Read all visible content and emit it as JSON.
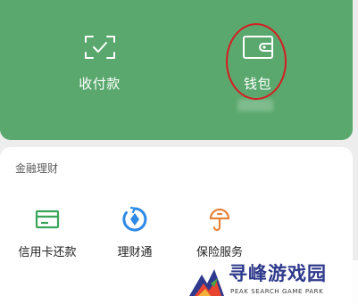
{
  "top_card": {
    "background": "#5aa86d",
    "actions": [
      {
        "label": "收付款",
        "icon": "scan-pay-icon"
      },
      {
        "label": "钱包",
        "icon": "wallet-icon"
      }
    ]
  },
  "annotation": {
    "circle_color": "#d51d22"
  },
  "finance": {
    "title": "金融理财",
    "items": [
      {
        "label": "信用卡还款",
        "icon": "credit-card-icon",
        "color": "#3aa55a"
      },
      {
        "label": "理财通",
        "icon": "licaitong-icon",
        "color": "#2d8ae6"
      },
      {
        "label": "保险服务",
        "icon": "insurance-icon",
        "color": "#e7833a"
      }
    ]
  },
  "watermark": {
    "title": "寻峰游戏园",
    "subtitle": "PEAK SEARCH GAME PARK"
  }
}
